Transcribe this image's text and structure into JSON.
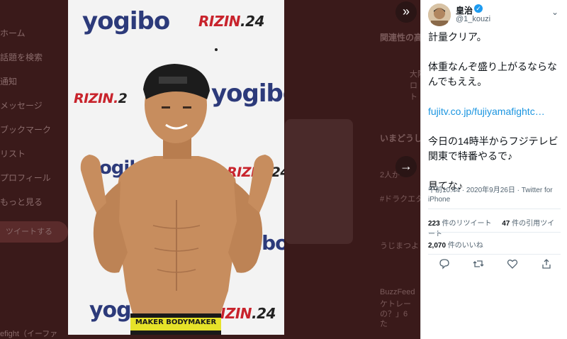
{
  "background": {
    "nav_items": [
      "ホーム",
      "話題を検索",
      "通知",
      "メッセージ",
      "ブックマーク",
      "リスト",
      "プロフィール",
      "もっと見る"
    ],
    "tweet_button_label": "ツイートする",
    "footer_text": "efight（イーファ",
    "right_column": {
      "related_label": "関連性の高",
      "trending_label": "いまどうし",
      "lines": [
        "大阪",
        "ロ",
        "ト",
        "2人が",
        "#ドラクエタ",
        "うじまつよ",
        "BuzzFeed",
        "ケトレー",
        "の？」6",
        "た"
      ]
    }
  },
  "photo": {
    "logos": {
      "yogibo_text": "yogibo",
      "rizin_text": "RIZIN",
      "rizin_number": ".24",
      "rizin_dot_text": "RIZIN.",
      "rizin_trunc_2": "2"
    },
    "waistband_text": "MAKER  BODYMAKER"
  },
  "controls": {
    "collapse_icon": "»",
    "next_icon": "→"
  },
  "tweet": {
    "user_name": "皇治",
    "verified_icon": "✓",
    "user_handle": "@1_kouzi",
    "chevron": "⌄",
    "lines": [
      "計量クリア。",
      "体重なんぞ盛り上がるならなんでもええ。",
      "fujitv.co.jp/fujiyamafightc…",
      "今日の14時半からフジテレビ　関東で特番やるで♪",
      "見てな♪"
    ],
    "timestamp": "午前10:44 · 2020年9月26日 · Twitter for iPhone",
    "retweets_count": "223",
    "retweets_label": "件のリツイート",
    "quotes_count": "47",
    "quotes_label": "件の引用ツイート",
    "likes_count": "2,070",
    "likes_label": "件のいいね",
    "actions": {
      "reply_icon": "reply-icon",
      "retweet_icon": "retweet-icon",
      "like_icon": "heart-icon",
      "share_icon": "share-icon"
    }
  },
  "colors": {
    "link": "#1b95e0",
    "verified": "#1d9bf0",
    "overlay": "#3a1a1a"
  }
}
